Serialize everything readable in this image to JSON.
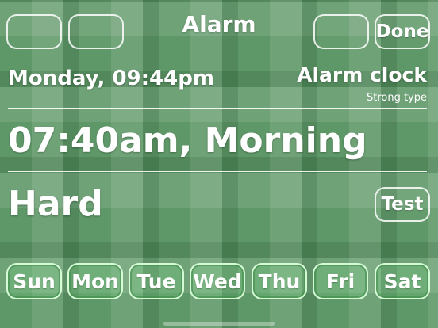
{
  "header": {
    "title": "Alarm",
    "done_label": "Done"
  },
  "status": {
    "current_datetime": "Monday, 09:44pm",
    "mode_title": "Alarm clock",
    "mode_subtitle": "Strong type"
  },
  "alarm": {
    "time_label": "07:40am, Morning",
    "difficulty": "Hard",
    "test_label": "Test"
  },
  "days": [
    {
      "label": "Sun"
    },
    {
      "label": "Mon"
    },
    {
      "label": "Tue"
    },
    {
      "label": "Wed"
    },
    {
      "label": "Thu"
    },
    {
      "label": "Fri"
    },
    {
      "label": "Sat"
    }
  ],
  "colors": {
    "background": "#5f9868",
    "text": "#ffffff",
    "day_selected": "#7cd887"
  }
}
